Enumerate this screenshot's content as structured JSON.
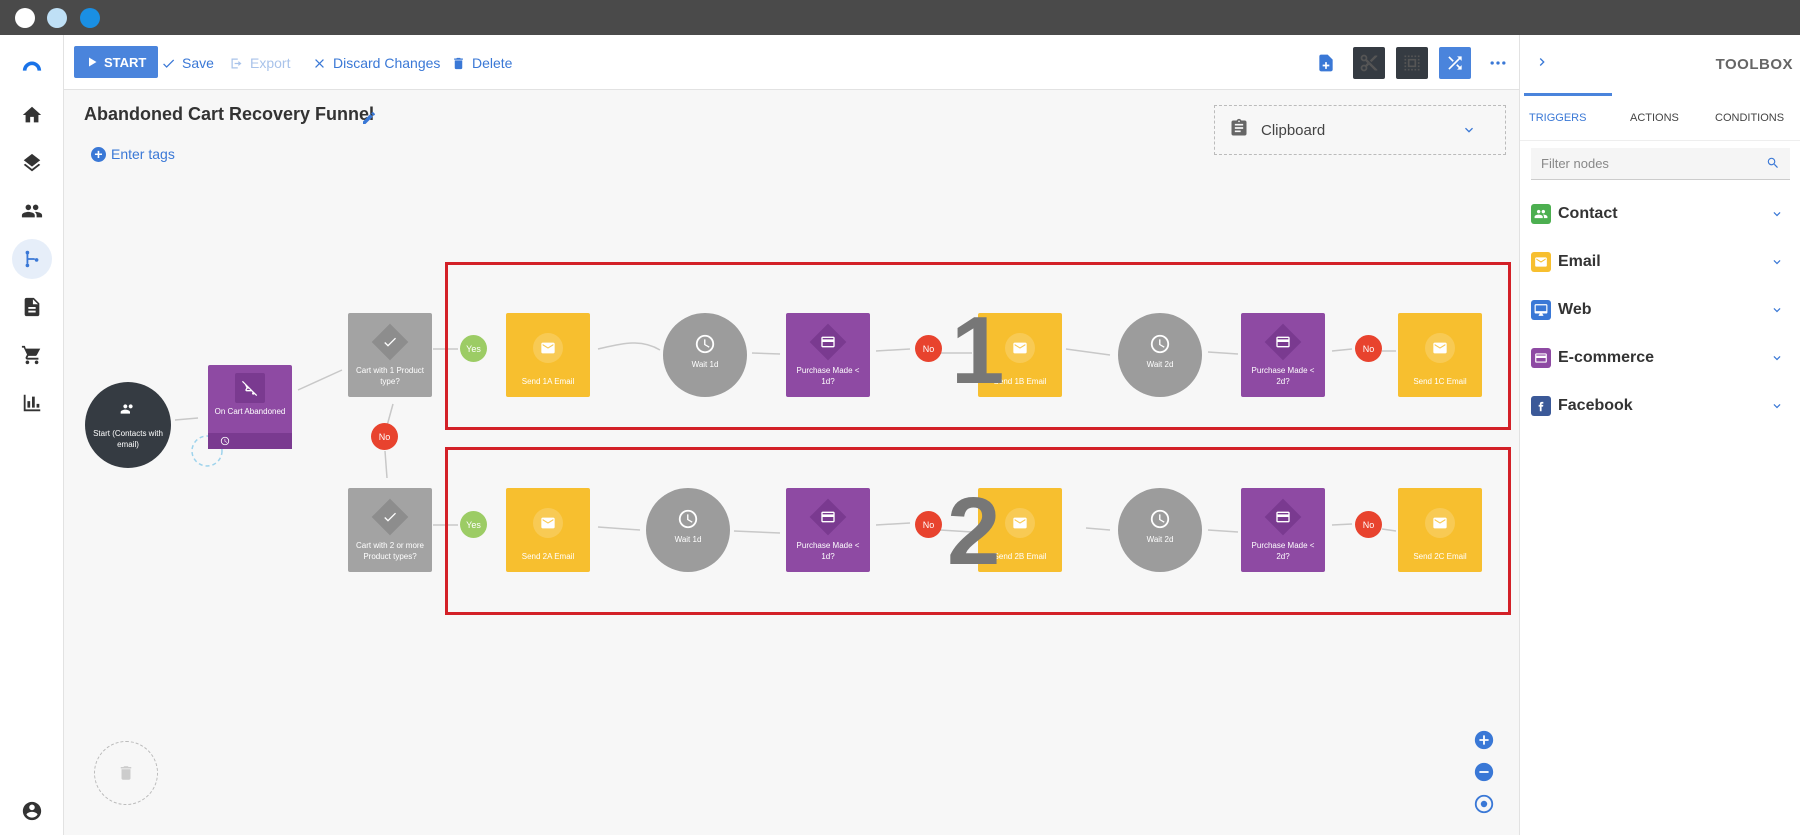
{
  "window": {
    "dots": [
      {
        "name": "close",
        "color": "#ffffff"
      },
      {
        "name": "minimize",
        "color": "#bfe0f6"
      },
      {
        "name": "maximize",
        "color": "#1a8fe3"
      }
    ]
  },
  "sidebar": {
    "items": [
      {
        "name": "logo",
        "icon": "logo-icon"
      },
      {
        "name": "home",
        "icon": "home-icon"
      },
      {
        "name": "layers",
        "icon": "layers-icon"
      },
      {
        "name": "contacts",
        "icon": "people-icon"
      },
      {
        "name": "workflows",
        "icon": "flow-icon",
        "active": true
      },
      {
        "name": "documents",
        "icon": "document-icon"
      },
      {
        "name": "shop",
        "icon": "cart-icon"
      },
      {
        "name": "reports",
        "icon": "bar-chart-icon"
      },
      {
        "name": "account",
        "icon": "account-icon"
      }
    ]
  },
  "toolbar": {
    "start_label": "START",
    "save_label": "Save",
    "export_label": "Export",
    "discard_label": "Discard Changes",
    "delete_label": "Delete",
    "icons": [
      "add-note-icon",
      "cut-icon",
      "select-icon",
      "shuffle-icon",
      "more-icon"
    ]
  },
  "canvas": {
    "title": "Abandoned Cart Recovery Funnel",
    "tags_label": "Enter tags",
    "clipboard_label": "Clipboard",
    "annotations": [
      "1",
      "2"
    ]
  },
  "flow": {
    "start": "Start (Contacts with email)",
    "trigger": "On Cart Abandoned",
    "condition_a": "Cart with 1 Product type?",
    "condition_b": "Cart with 2 or more Product types?",
    "row1": {
      "email_a": "Send 1A Email",
      "wait_a": "Wait 1d",
      "check_a": "Purchase Made < 1d?",
      "email_b": "Send 1B Email",
      "wait_b": "Wait 2d",
      "check_b": "Purchase Made < 2d?",
      "email_c": "Send 1C Email"
    },
    "row2": {
      "email_a": "Send 2A Email",
      "wait_a": "Wait 1d",
      "check_a": "Purchase Made < 1d?",
      "email_b": "Send 2B Email",
      "wait_b": "Wait 2d",
      "check_b": "Purchase Made < 2d?",
      "email_c": "Send 2C Email"
    },
    "yes_label": "Yes",
    "no_label": "No",
    "colors": {
      "email": "#f7bf2f",
      "check": "#8e4aa3",
      "wait": "#9c9c9c",
      "condition": "#a3a3a3",
      "start": "#353b42",
      "yes": "#9ccc65",
      "no": "#e8432e",
      "highlight": "#d32027"
    }
  },
  "toolbox": {
    "title": "TOOLBOX",
    "tabs": [
      "TRIGGERS",
      "ACTIONS",
      "CONDITIONS"
    ],
    "active_tab": "TRIGGERS",
    "filter_placeholder": "Filter nodes",
    "categories": [
      {
        "label": "Contact",
        "color": "#4caf50",
        "icon": "people-icon"
      },
      {
        "label": "Email",
        "color": "#f7bf2f",
        "icon": "email-icon"
      },
      {
        "label": "Web",
        "color": "#3a78d6",
        "icon": "monitor-icon"
      },
      {
        "label": "E-commerce",
        "color": "#8e4aa3",
        "icon": "card-icon"
      },
      {
        "label": "Facebook",
        "color": "#3b5998",
        "icon": "facebook-icon"
      }
    ]
  },
  "zoom_controls": [
    "zoom-in-icon",
    "zoom-out-icon",
    "recenter-icon"
  ]
}
